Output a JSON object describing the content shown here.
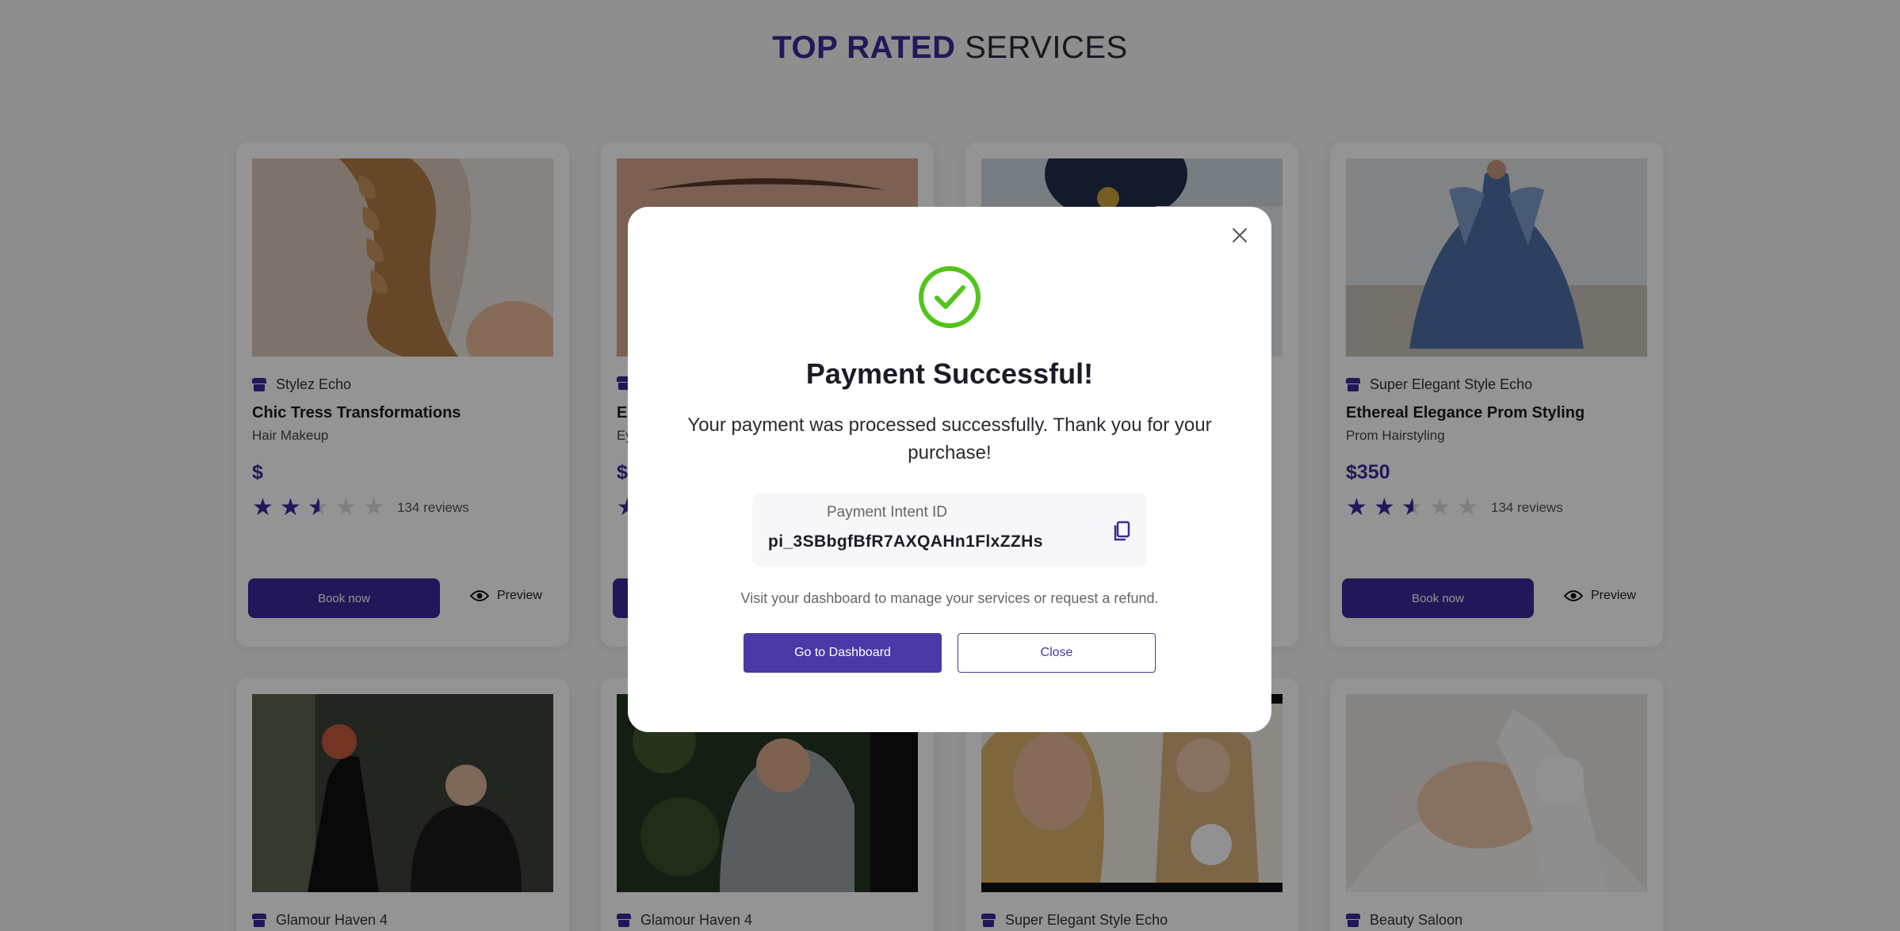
{
  "section": {
    "title_highlight": "TOP RATED",
    "title_rest": "SERVICES"
  },
  "cards_row1": [
    {
      "shop": "Stylez Echo",
      "name": "Chic Tress Transformations",
      "category": "Hair Makeup",
      "price": "$",
      "reviews": "134 reviews",
      "book": "Book now",
      "preview": "Preview"
    },
    {
      "shop": "",
      "name": "E",
      "category": "Ey",
      "price": "$",
      "reviews": "",
      "book": "",
      "preview": ""
    },
    {
      "shop": "",
      "name": "",
      "category": "",
      "price": "",
      "reviews": "",
      "book": "",
      "preview": ""
    },
    {
      "shop": "Super Elegant Style Echo",
      "name": "Ethereal Elegance Prom Styling",
      "category": "Prom Hairstyling",
      "price": "$350",
      "reviews": "134 reviews",
      "book": "Book now",
      "preview": "Preview"
    }
  ],
  "cards_row2": [
    {
      "shop": "Glamour Haven 4"
    },
    {
      "shop": "Glamour Haven 4"
    },
    {
      "shop": "Super Elegant Style Echo"
    },
    {
      "shop": "Beauty Saloon"
    }
  ],
  "rating": {
    "value": 2.5,
    "max": 5
  },
  "modal": {
    "title": "Payment Successful!",
    "message": "Your payment was processed successfully. Thank you for your purchase!",
    "pi_label": "Payment Intent ID",
    "pi_value": "pi_3SBbgfBfR7AXQAHn1FlxZZHs",
    "visit_text": "Visit your dashboard to manage your services or request a refund.",
    "dashboard_button": "Go to Dashboard",
    "close_button": "Close"
  },
  "colors": {
    "accent": "#3b2a9a",
    "success": "#52c41a",
    "button": "#4a39a6"
  }
}
